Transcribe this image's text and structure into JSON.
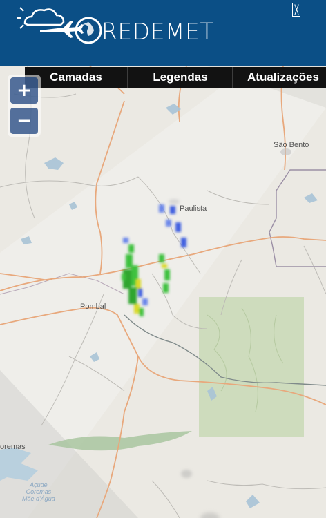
{
  "header": {
    "brand_name": "REDEMET",
    "close_icon": "close-icon"
  },
  "tabs": [
    {
      "label": "Camadas"
    },
    {
      "label": "Legendas"
    },
    {
      "label": "Atualizações"
    }
  ],
  "zoom": {
    "zoom_in_label": "+",
    "zoom_out_label": "−"
  },
  "places": {
    "sao_bento": "São Bento",
    "paulista": "Paulista",
    "pombal": "Pombal",
    "coremas": "oremas",
    "acude_line1": "Açude",
    "acude_line2": "Coremas",
    "acude_line3": "Mãe d'Água"
  },
  "colors": {
    "header_bg": "#0b4f86",
    "tab_bg": "#121212",
    "radar_blue": "#3f5fe0",
    "radar_green": "#3ec13e",
    "radar_yellow": "#d9d92a",
    "road_orange": "#e8a87c",
    "reserve_green": "#c9d9b6"
  }
}
